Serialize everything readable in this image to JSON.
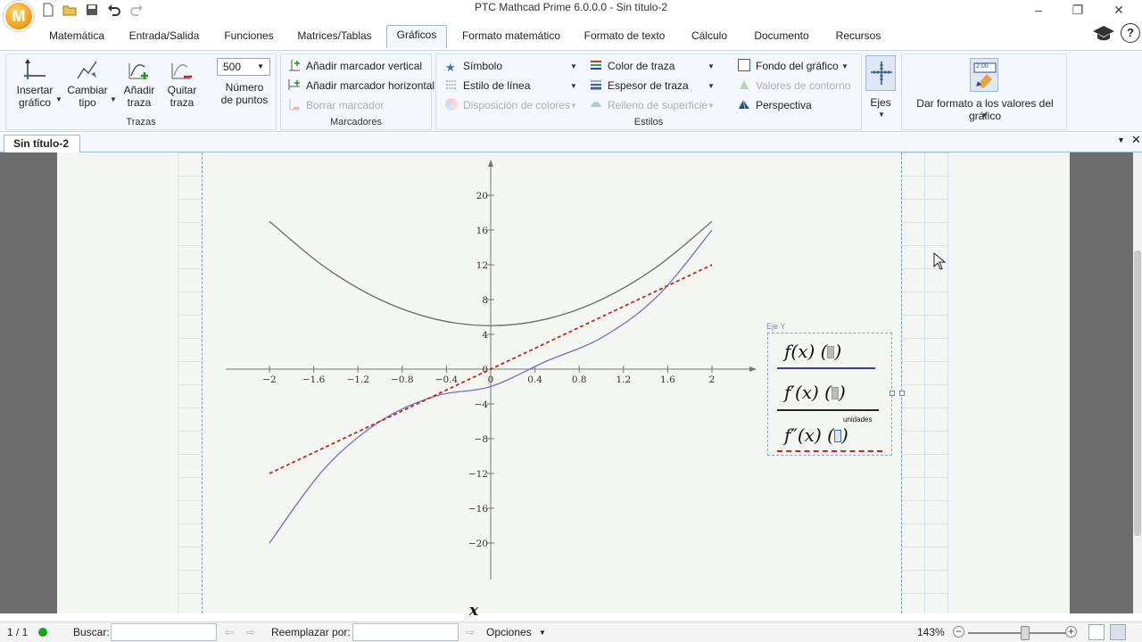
{
  "window": {
    "title": "PTC Mathcad Prime 6.0.0.0 - Sin título-2",
    "logo_letter": "M"
  },
  "tabs": [
    {
      "label": "Matemática"
    },
    {
      "label": "Entrada/Salida"
    },
    {
      "label": "Funciones"
    },
    {
      "label": "Matrices/Tablas"
    },
    {
      "label": "Gráficos",
      "active": true
    },
    {
      "label": "Formato matemático"
    },
    {
      "label": "Formato de texto"
    },
    {
      "label": "Cálculo"
    },
    {
      "label": "Documento"
    },
    {
      "label": "Recursos"
    }
  ],
  "ribbon": {
    "trazas": {
      "label": "Trazas",
      "insertar": "Insertar gráfico",
      "insertar_l1": "Insertar",
      "insertar_l2": "gráfico",
      "cambiar_l1": "Cambiar",
      "cambiar_l2": "tipo",
      "anadir_l1": "Añadir",
      "anadir_l2": "traza",
      "quitar_l1": "Quitar",
      "quitar_l2": "traza",
      "num_points_value": "500",
      "num_points_l1": "Número",
      "num_points_l2": "de puntos"
    },
    "marcadores": {
      "label": "Marcadores",
      "vertical": "Añadir marcador vertical",
      "horizontal": "Añadir marcador horizontal",
      "borrar": "Borrar marcador"
    },
    "estilos": {
      "label": "Estilos",
      "simbolo": "Símbolo",
      "estilo_linea": "Estilo de línea",
      "disposicion": "Disposición de colores",
      "color_traza": "Color de traza",
      "espesor_traza": "Espesor de traza",
      "relleno": "Relleno de superficie",
      "fondo": "Fondo del gráfico",
      "valores_contorno": "Valores de contorno",
      "perspectiva": "Perspectiva"
    },
    "ejes": "Ejes",
    "formato_valores": "Dar formato a los valores del gráfico",
    "formato_icon_text": "2.00"
  },
  "document_tab": "Sin título-2",
  "colors": {
    "trace_fprime": "#6d6d6d",
    "trace_f": "#7070c0",
    "trace_fsecond": "#cc2222",
    "ribbon_bg": "#f4f8fc",
    "accent": "#3b6fb6"
  },
  "plot": {
    "x_variable": "x",
    "legend_caption": "Eje Y",
    "legend_units": "unidades",
    "legend": [
      {
        "label": "f(x)",
        "line_color": "#3a3aa0",
        "line_style": "solid"
      },
      {
        "label": "f′(x)",
        "line_color": "#222222",
        "line_style": "solid"
      },
      {
        "label": "f″(x)",
        "line_color": "#cc2222",
        "line_style": "dashed"
      }
    ]
  },
  "chart_data": {
    "type": "line",
    "title": "",
    "xlabel": "x",
    "ylabel": "",
    "xlim": [
      -2.5,
      2.95
    ],
    "ylim": [
      -24,
      24
    ],
    "x_ticks": [
      -2,
      -1.6,
      -1.2,
      -0.8,
      -0.4,
      0,
      0.4,
      0.8,
      1.2,
      1.6,
      2
    ],
    "x_tick_labels": [
      "−2",
      "−1.6",
      "−1.2",
      "−0.8",
      "−0.4",
      "0",
      "0.4",
      "0.8",
      "1.2",
      "1.6",
      "2"
    ],
    "y_ticks": [
      20,
      16,
      12,
      8,
      4,
      0,
      -4,
      -8,
      -12,
      -16,
      -20
    ],
    "y_tick_labels": [
      "20",
      "16",
      "12",
      "8",
      "4",
      "0",
      "−4",
      "−8",
      "−12",
      "−16",
      "−20"
    ],
    "grid": false,
    "series": [
      {
        "name": "f(x)",
        "color": "#7070c0",
        "style": "solid",
        "x": [
          -2,
          -1.5,
          -1,
          -0.5,
          0,
          0.5,
          1,
          1.5,
          2
        ],
        "y": [
          -20,
          -11.4,
          -6.0,
          -3.1,
          -2.0,
          0.9,
          3.6,
          8.3,
          16.0
        ]
      },
      {
        "name": "f′(x)",
        "color": "#6d6d6d",
        "style": "solid",
        "x": [
          -2,
          -1.5,
          -1,
          -0.5,
          0,
          0.5,
          1,
          1.5,
          2
        ],
        "y": [
          17,
          11.75,
          8,
          5.75,
          5,
          5.75,
          8,
          11.75,
          17
        ]
      },
      {
        "name": "f″(x)",
        "color": "#cc2222",
        "style": "dashed",
        "x": [
          -2,
          0,
          2
        ],
        "y": [
          -12,
          0,
          12
        ]
      }
    ]
  },
  "statusbar": {
    "page": "1 / 1",
    "buscar": "Buscar:",
    "reemplazar": "Reemplazar por:",
    "opciones": "Opciones",
    "zoom": "143%"
  }
}
